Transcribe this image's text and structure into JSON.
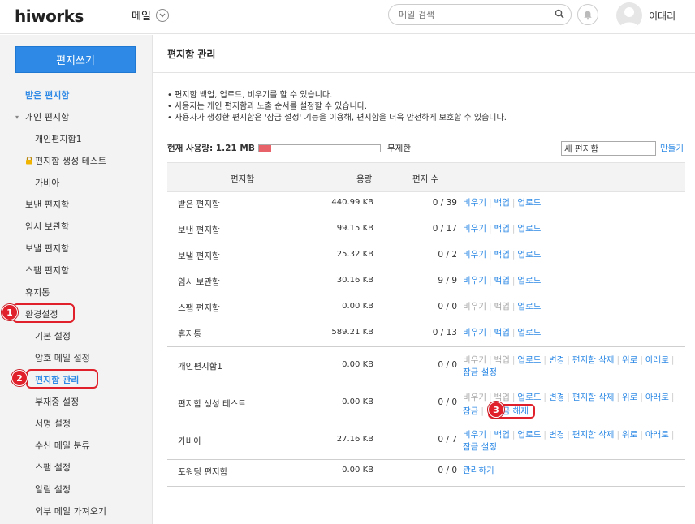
{
  "header": {
    "logo": "hiworks",
    "app_menu_label": "메일",
    "search_placeholder": "메일 검색",
    "username": "이대리"
  },
  "sidebar": {
    "compose_label": "편지쓰기",
    "items": [
      {
        "label": "받은 편지함",
        "level": 0,
        "state": "active"
      },
      {
        "label": "개인 편지함",
        "level": 0,
        "caret": "▾"
      },
      {
        "label": "개인편지함1",
        "level": 1
      },
      {
        "label": "편지함 생성 테스트",
        "level": 1,
        "locked": true
      },
      {
        "label": "가비아",
        "level": 1
      },
      {
        "label": "보낸 편지함",
        "level": 0
      },
      {
        "label": "임시 보관함",
        "level": 0
      },
      {
        "label": "보낼 편지함",
        "level": 0
      },
      {
        "label": "스팸 편지함",
        "level": 0
      },
      {
        "label": "휴지통",
        "level": 0
      },
      {
        "label": "환경설정",
        "level": 0
      },
      {
        "label": "기본 설정",
        "level": 1
      },
      {
        "label": "암호 메일 설정",
        "level": 1
      },
      {
        "label": "편지함 관리",
        "level": 1,
        "state": "strong"
      },
      {
        "label": "부재중 설정",
        "level": 1
      },
      {
        "label": "서명 설정",
        "level": 1
      },
      {
        "label": "수신 메일 분류",
        "level": 1
      },
      {
        "label": "스팸 설정",
        "level": 1
      },
      {
        "label": "알림 설정",
        "level": 1
      },
      {
        "label": "외부 메일 가져오기",
        "level": 1
      }
    ]
  },
  "annotations": {
    "marker1": "1",
    "marker2": "2",
    "marker3": "3"
  },
  "main": {
    "title": "편지함 관리",
    "notes": [
      "• 편지함 백업, 업로드, 비우기를 할 수 있습니다.",
      "• 사용자는 개인 편지함과 노출 순서를 설정할 수 있습니다.",
      "• 사용자가 생성한 편지함은 '잠금 설정' 기능을 이용해, 편지함을 더욱 안전하게 보호할 수 있습니다."
    ],
    "usage_label": "현재 사용량: 1.21 MB",
    "usage_fraction": 0.1,
    "usage_limit": "무제한",
    "new_folder_value": "새 편지함",
    "create_label": "만들기",
    "columns": {
      "name": "편지함",
      "size": "용량",
      "count": "편지 수"
    },
    "rows": [
      {
        "name": "받은 편지함",
        "size": "440.99 KB",
        "count": "0 / 39",
        "actions": [
          "비우기",
          "백업",
          "업로드"
        ]
      },
      {
        "name": "보낸 편지함",
        "size": "99.15 KB",
        "count": "0 / 17",
        "actions": [
          "비우기",
          "백업",
          "업로드"
        ]
      },
      {
        "name": "보낼 편지함",
        "size": "25.32 KB",
        "count": "0 / 2",
        "actions": [
          "비우기",
          "백업",
          "업로드"
        ]
      },
      {
        "name": "임시 보관함",
        "size": "30.16 KB",
        "count": "9 / 9",
        "actions": [
          "비우기",
          "백업",
          "업로드"
        ]
      },
      {
        "name": "스팸 편지함",
        "size": "0.00 KB",
        "count": "0 / 0",
        "actions": [
          "비우기",
          "백업",
          "업로드"
        ],
        "disabled": [
          0,
          1
        ]
      },
      {
        "name": "휴지통",
        "size": "589.21 KB",
        "count": "0 / 13",
        "actions": [
          "비우기",
          "백업",
          "업로드"
        ]
      },
      {
        "name": "개인편지함1",
        "size": "0.00 KB",
        "count": "0 / 0",
        "actions": [
          "비우기",
          "백업",
          "업로드",
          "변경",
          "편지함 삭제",
          "위로",
          "아래로",
          "잠금 설정"
        ],
        "disabled": [
          0,
          1
        ]
      },
      {
        "name": "편지함 생성 테스트",
        "size": "0.00 KB",
        "count": "0 / 0",
        "actions": [
          "비우기",
          "백업",
          "업로드",
          "변경",
          "편지함 삭제",
          "위로",
          "아래로",
          "잠금",
          "잠금 해제"
        ],
        "disabled": [
          0,
          1
        ]
      },
      {
        "name": "가비아",
        "size": "27.16 KB",
        "count": "0 / 7",
        "actions": [
          "비우기",
          "백업",
          "업로드",
          "변경",
          "편지함 삭제",
          "위로",
          "아래로",
          "잠금 설정"
        ]
      },
      {
        "name": "포워딩 편지함",
        "size": "0.00 KB",
        "count": "0 / 0",
        "actions": [
          "관리하기"
        ]
      }
    ]
  },
  "colors": {
    "accent": "#2d89e5",
    "marker": "#e0202a",
    "usage_fill": "#e8626a"
  }
}
